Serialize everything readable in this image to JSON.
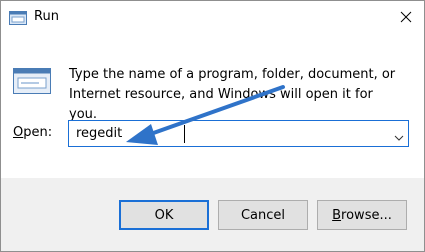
{
  "window": {
    "title": "Run"
  },
  "dialog": {
    "description": "Type the name of a program, folder, document, or Internet resource, and Windows will open it for you.",
    "open_label_prefix": "O",
    "open_label_rest": "pen:",
    "open_value": "regedit"
  },
  "buttons": {
    "ok": "OK",
    "cancel": "Cancel",
    "browse_prefix": "B",
    "browse_rest": "rowse..."
  },
  "annotation": {
    "arrow_color": "#2f73c9"
  },
  "icons": {
    "app": "run-icon",
    "close": "close-icon",
    "dropdown": "chevron-down-icon",
    "program": "run-program-icon"
  },
  "colors": {
    "accent": "#1a6fd6",
    "footer": "#f0f0f0"
  }
}
